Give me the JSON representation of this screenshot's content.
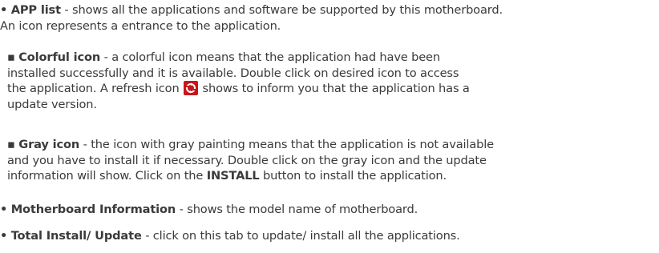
{
  "items": [
    {
      "bullet": "•",
      "term": "APP list",
      "line1": " - shows all the applications and software be supported by this motherboard.",
      "line2": "An icon represents a entrance to the application."
    }
  ],
  "sub_items": [
    {
      "bullet": "▪",
      "term": "Colorful icon",
      "line1": " - a colorful icon means that the application had have been",
      "line2": "installed successfully and it is available. Double click on desired icon to access",
      "line3_before": "the application.  A refresh icon ",
      "line3_after": " shows to inform you that the application has a",
      "line4": "update version."
    },
    {
      "bullet": "▪",
      "term": "Gray icon",
      "line1": " - the icon with gray painting means that the application is not available",
      "line2": "and you have to install it if necessary. Double click on the gray icon and the update",
      "line3_before": "information will show. Click on the ",
      "line3_bold": "INSTALL",
      "line3_after": " button to install the application."
    }
  ],
  "bottom_items": [
    {
      "bullet": "•",
      "term": "Motherboard Information",
      "text": " - shows the model name of motherboard."
    },
    {
      "bullet": "•",
      "term": "Total Install/ Update",
      "text": " - click on this tab to update/ install all the applications."
    }
  ],
  "colors": {
    "text": "#3a3a3a",
    "refresh_icon_bg": "#c8161d",
    "refresh_icon_fg": "#ffffff"
  },
  "icons": {
    "refresh": "refresh-icon"
  }
}
